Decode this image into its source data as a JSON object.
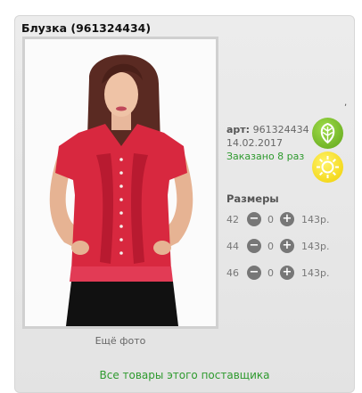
{
  "product": {
    "title": "Блузка (961324434)",
    "more_photos": "Ещё фото",
    "art_label": "арт:",
    "art_value": "961324434",
    "date": "14.02.2017",
    "ordered": "Заказано 8 раз",
    "edge_mark": ","
  },
  "icons": {
    "leaf": "leaf-icon",
    "sun": "sun-icon"
  },
  "sizes": {
    "title": "Размеры",
    "rows": [
      {
        "size": "42",
        "qty": "0",
        "price": "143р."
      },
      {
        "size": "44",
        "qty": "0",
        "price": "143р."
      },
      {
        "size": "46",
        "qty": "0",
        "price": "143р."
      }
    ]
  },
  "footer": {
    "supplier_link": "Все товары этого поставщика"
  },
  "colors": {
    "link_green": "#2e9a2e",
    "blouse_red": "#d8283f",
    "leaf_green": "#6cb523",
    "sun_yellow": "#f7dd1d"
  }
}
